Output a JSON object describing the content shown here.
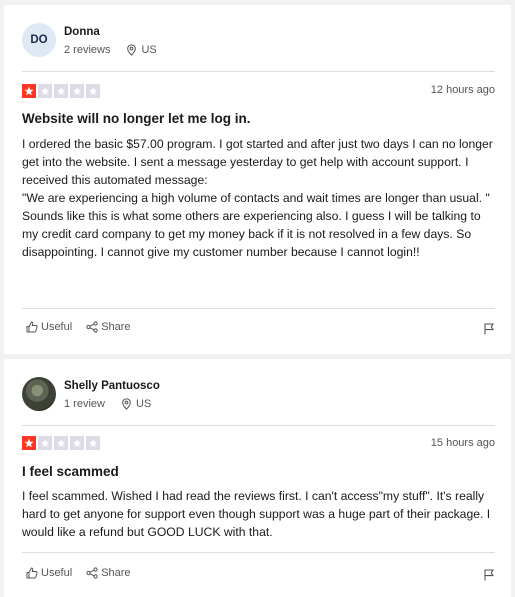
{
  "colors": {
    "star_filled": "#ff3722",
    "star_empty": "#dcdce6",
    "avatar_bg": "#dfe8f5"
  },
  "reviews": [
    {
      "avatar_initials": "DO",
      "reviewer_name": "Donna",
      "review_count": "2 reviews",
      "country": "US",
      "rating": 1,
      "max_rating": 5,
      "date": "12 hours ago",
      "title": "Website will no longer let me log in.",
      "body": [
        "I ordered the basic $57.00 program. I got started and after just two days I can no longer get into the website. I sent a message yesterday to get help with account support. I received this automated message:",
        "\"We are experiencing a high volume of contacts and wait times are longer than usual. \"",
        "Sounds like this is what some others are experiencing also. I guess I will be talking to my credit card company to get my money back if it is not resolved in a few days. So disappointing. I cannot give my customer number because I cannot login!!"
      ],
      "useful_label": "Useful",
      "share_label": "Share"
    },
    {
      "avatar_initials": "",
      "reviewer_name": "Shelly Pantuosco",
      "review_count": "1 review",
      "country": "US",
      "rating": 1,
      "max_rating": 5,
      "date": "15 hours ago",
      "title": "I feel scammed",
      "body": [
        "I feel scammed. Wished I had read the reviews first. I can't access\"my stuff\". It's really hard to get anyone for support even though support was a huge part of their package. I would like a refund but GOOD LUCK with that."
      ],
      "useful_label": "Useful",
      "share_label": "Share"
    }
  ]
}
